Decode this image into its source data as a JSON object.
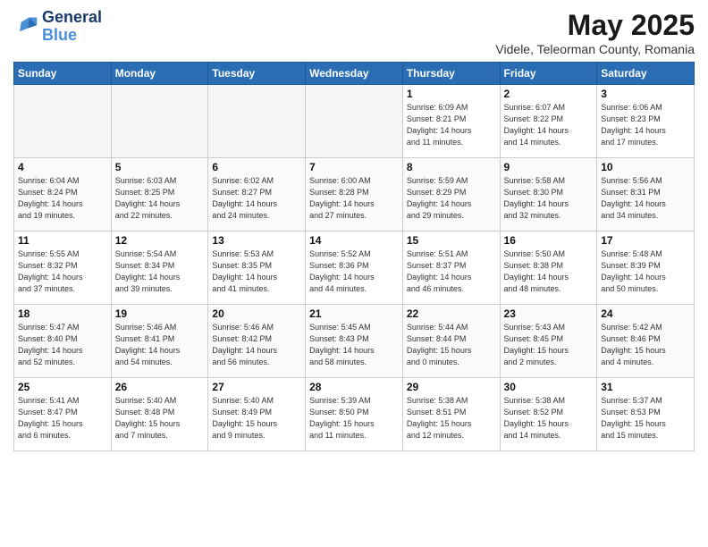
{
  "logo": {
    "line1": "General",
    "line2": "Blue"
  },
  "title": "May 2025",
  "subtitle": "Videle, Teleorman County, Romania",
  "days_of_week": [
    "Sunday",
    "Monday",
    "Tuesday",
    "Wednesday",
    "Thursday",
    "Friday",
    "Saturday"
  ],
  "weeks": [
    [
      {
        "day": "",
        "info": ""
      },
      {
        "day": "",
        "info": ""
      },
      {
        "day": "",
        "info": ""
      },
      {
        "day": "",
        "info": ""
      },
      {
        "day": "1",
        "info": "Sunrise: 6:09 AM\nSunset: 8:21 PM\nDaylight: 14 hours\nand 11 minutes."
      },
      {
        "day": "2",
        "info": "Sunrise: 6:07 AM\nSunset: 8:22 PM\nDaylight: 14 hours\nand 14 minutes."
      },
      {
        "day": "3",
        "info": "Sunrise: 6:06 AM\nSunset: 8:23 PM\nDaylight: 14 hours\nand 17 minutes."
      }
    ],
    [
      {
        "day": "4",
        "info": "Sunrise: 6:04 AM\nSunset: 8:24 PM\nDaylight: 14 hours\nand 19 minutes."
      },
      {
        "day": "5",
        "info": "Sunrise: 6:03 AM\nSunset: 8:25 PM\nDaylight: 14 hours\nand 22 minutes."
      },
      {
        "day": "6",
        "info": "Sunrise: 6:02 AM\nSunset: 8:27 PM\nDaylight: 14 hours\nand 24 minutes."
      },
      {
        "day": "7",
        "info": "Sunrise: 6:00 AM\nSunset: 8:28 PM\nDaylight: 14 hours\nand 27 minutes."
      },
      {
        "day": "8",
        "info": "Sunrise: 5:59 AM\nSunset: 8:29 PM\nDaylight: 14 hours\nand 29 minutes."
      },
      {
        "day": "9",
        "info": "Sunrise: 5:58 AM\nSunset: 8:30 PM\nDaylight: 14 hours\nand 32 minutes."
      },
      {
        "day": "10",
        "info": "Sunrise: 5:56 AM\nSunset: 8:31 PM\nDaylight: 14 hours\nand 34 minutes."
      }
    ],
    [
      {
        "day": "11",
        "info": "Sunrise: 5:55 AM\nSunset: 8:32 PM\nDaylight: 14 hours\nand 37 minutes."
      },
      {
        "day": "12",
        "info": "Sunrise: 5:54 AM\nSunset: 8:34 PM\nDaylight: 14 hours\nand 39 minutes."
      },
      {
        "day": "13",
        "info": "Sunrise: 5:53 AM\nSunset: 8:35 PM\nDaylight: 14 hours\nand 41 minutes."
      },
      {
        "day": "14",
        "info": "Sunrise: 5:52 AM\nSunset: 8:36 PM\nDaylight: 14 hours\nand 44 minutes."
      },
      {
        "day": "15",
        "info": "Sunrise: 5:51 AM\nSunset: 8:37 PM\nDaylight: 14 hours\nand 46 minutes."
      },
      {
        "day": "16",
        "info": "Sunrise: 5:50 AM\nSunset: 8:38 PM\nDaylight: 14 hours\nand 48 minutes."
      },
      {
        "day": "17",
        "info": "Sunrise: 5:48 AM\nSunset: 8:39 PM\nDaylight: 14 hours\nand 50 minutes."
      }
    ],
    [
      {
        "day": "18",
        "info": "Sunrise: 5:47 AM\nSunset: 8:40 PM\nDaylight: 14 hours\nand 52 minutes."
      },
      {
        "day": "19",
        "info": "Sunrise: 5:46 AM\nSunset: 8:41 PM\nDaylight: 14 hours\nand 54 minutes."
      },
      {
        "day": "20",
        "info": "Sunrise: 5:46 AM\nSunset: 8:42 PM\nDaylight: 14 hours\nand 56 minutes."
      },
      {
        "day": "21",
        "info": "Sunrise: 5:45 AM\nSunset: 8:43 PM\nDaylight: 14 hours\nand 58 minutes."
      },
      {
        "day": "22",
        "info": "Sunrise: 5:44 AM\nSunset: 8:44 PM\nDaylight: 15 hours\nand 0 minutes."
      },
      {
        "day": "23",
        "info": "Sunrise: 5:43 AM\nSunset: 8:45 PM\nDaylight: 15 hours\nand 2 minutes."
      },
      {
        "day": "24",
        "info": "Sunrise: 5:42 AM\nSunset: 8:46 PM\nDaylight: 15 hours\nand 4 minutes."
      }
    ],
    [
      {
        "day": "25",
        "info": "Sunrise: 5:41 AM\nSunset: 8:47 PM\nDaylight: 15 hours\nand 6 minutes."
      },
      {
        "day": "26",
        "info": "Sunrise: 5:40 AM\nSunset: 8:48 PM\nDaylight: 15 hours\nand 7 minutes."
      },
      {
        "day": "27",
        "info": "Sunrise: 5:40 AM\nSunset: 8:49 PM\nDaylight: 15 hours\nand 9 minutes."
      },
      {
        "day": "28",
        "info": "Sunrise: 5:39 AM\nSunset: 8:50 PM\nDaylight: 15 hours\nand 11 minutes."
      },
      {
        "day": "29",
        "info": "Sunrise: 5:38 AM\nSunset: 8:51 PM\nDaylight: 15 hours\nand 12 minutes."
      },
      {
        "day": "30",
        "info": "Sunrise: 5:38 AM\nSunset: 8:52 PM\nDaylight: 15 hours\nand 14 minutes."
      },
      {
        "day": "31",
        "info": "Sunrise: 5:37 AM\nSunset: 8:53 PM\nDaylight: 15 hours\nand 15 minutes."
      }
    ]
  ]
}
